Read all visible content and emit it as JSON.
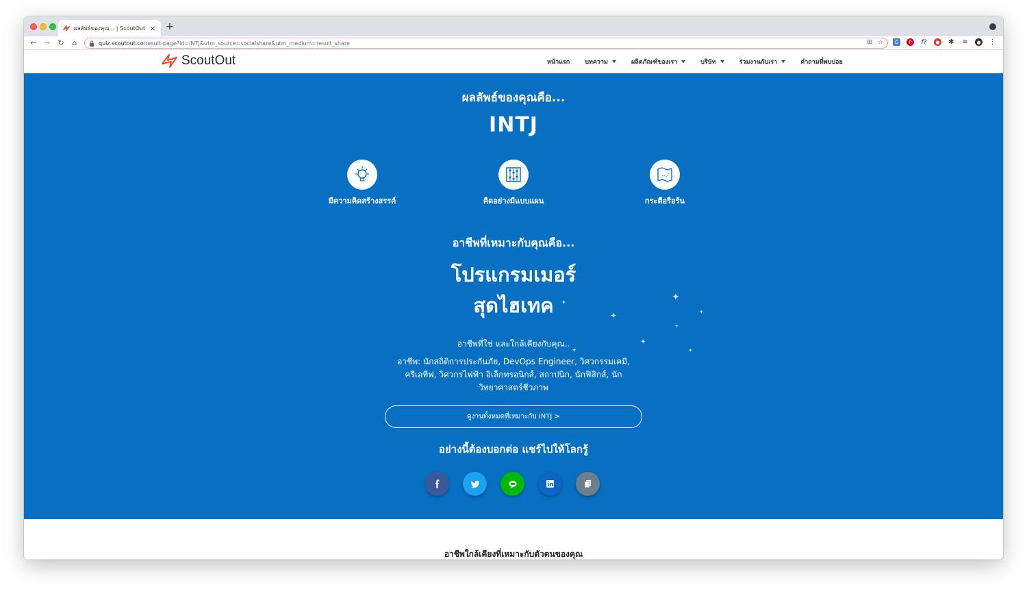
{
  "browser": {
    "tab_title": "ผลลัพธ์ของคุณ... | ScoutOut",
    "url_host": "quiz.scoutout.co",
    "url_rest": "/result-page?id=INTJ&utm_source=socialshare&utm_medium=result_share"
  },
  "header": {
    "logo": "ScoutOut",
    "menu": [
      {
        "label": "หน้าแรก",
        "dropdown": false
      },
      {
        "label": "บทความ",
        "dropdown": true
      },
      {
        "label": "ผลิตภัณฑ์ของเรา",
        "dropdown": true
      },
      {
        "label": "บริษัท",
        "dropdown": true
      },
      {
        "label": "ร่วมงานกับเรา",
        "dropdown": true
      },
      {
        "label": "คำถามที่พบบ่อย",
        "dropdown": false
      }
    ]
  },
  "hero": {
    "result_label": "ผลลัพธ์ของคุณคือ...",
    "result_type": "INTJ",
    "traits": [
      {
        "label": "มีความคิดสร้างสรรค์",
        "icon": "lightbulb-icon"
      },
      {
        "label": "คิดอย่างมีแบบแผน",
        "icon": "abacus-icon"
      },
      {
        "label": "กระตือรือร้น",
        "icon": "map-icon"
      }
    ],
    "career_label": "อาชีพที่เหมาะกับคุณคือ...",
    "career_line1": "โปรแกรมเมอร์",
    "career_line2": "สุดไฮเทค",
    "close_label": "อาชีพที่ใช่ และใกล้เคียงกับคุณ..",
    "jobs_text": "อาชีพ: นักสถิติการประกันภัย, DevOps Engineer, วิศวกรรมเคมี, ครีเอทีฟ, วิศวกรไฟฟ้า อิเล็กทรอนิกส์, สถาปนิก, นักฟิสิกส์, นักวิทยาศาสตร์ชีวภาพ",
    "all_jobs_button": "ดูงานทั้งหมดที่เหมาะกับ INTJ >",
    "share_title": "อย่างนี้ต้องบอกต่อ แชร์ไปให้โลกรู้",
    "share_buttons": [
      {
        "name": "facebook",
        "color": "#3b5998",
        "glyph": "f"
      },
      {
        "name": "twitter",
        "color": "#1da1f2",
        "glyph": "t"
      },
      {
        "name": "line",
        "color": "#00b900",
        "glyph": "L"
      },
      {
        "name": "linkedin",
        "color": "#0a66c2",
        "glyph": "in"
      },
      {
        "name": "copy",
        "color": "#6d7f8c",
        "glyph": "c"
      }
    ]
  },
  "similar_title": "อาชีพใกล้เคียงที่เหมาะกับตัวตนของคุณ",
  "colors": {
    "hero_bg": "#0770c2",
    "brand_red": "#e8482f"
  }
}
